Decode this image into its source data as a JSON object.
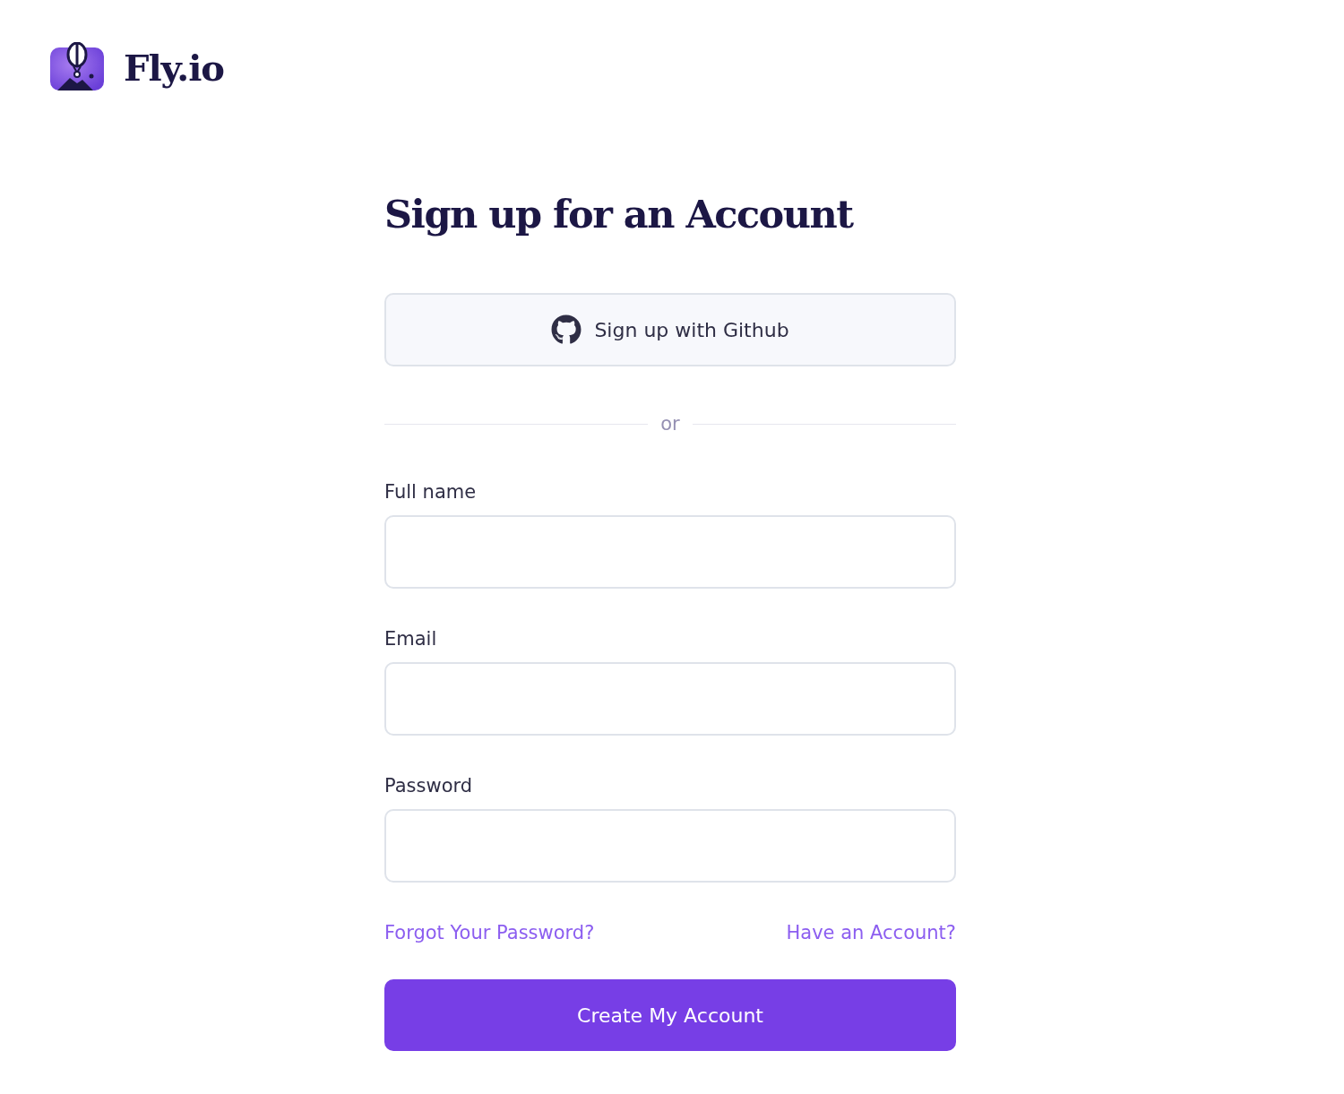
{
  "brand": {
    "name": "Fly.io"
  },
  "title": "Sign up for an Account",
  "github_button": {
    "label": "Sign up with Github"
  },
  "divider": {
    "label": "or"
  },
  "fields": [
    {
      "label": "Full name"
    },
    {
      "label": "Email"
    },
    {
      "label": "Password"
    }
  ],
  "links": [
    "Forgot Your Password?",
    "Have an Account?"
  ],
  "submit_button": {
    "label": "Create My Account"
  }
}
